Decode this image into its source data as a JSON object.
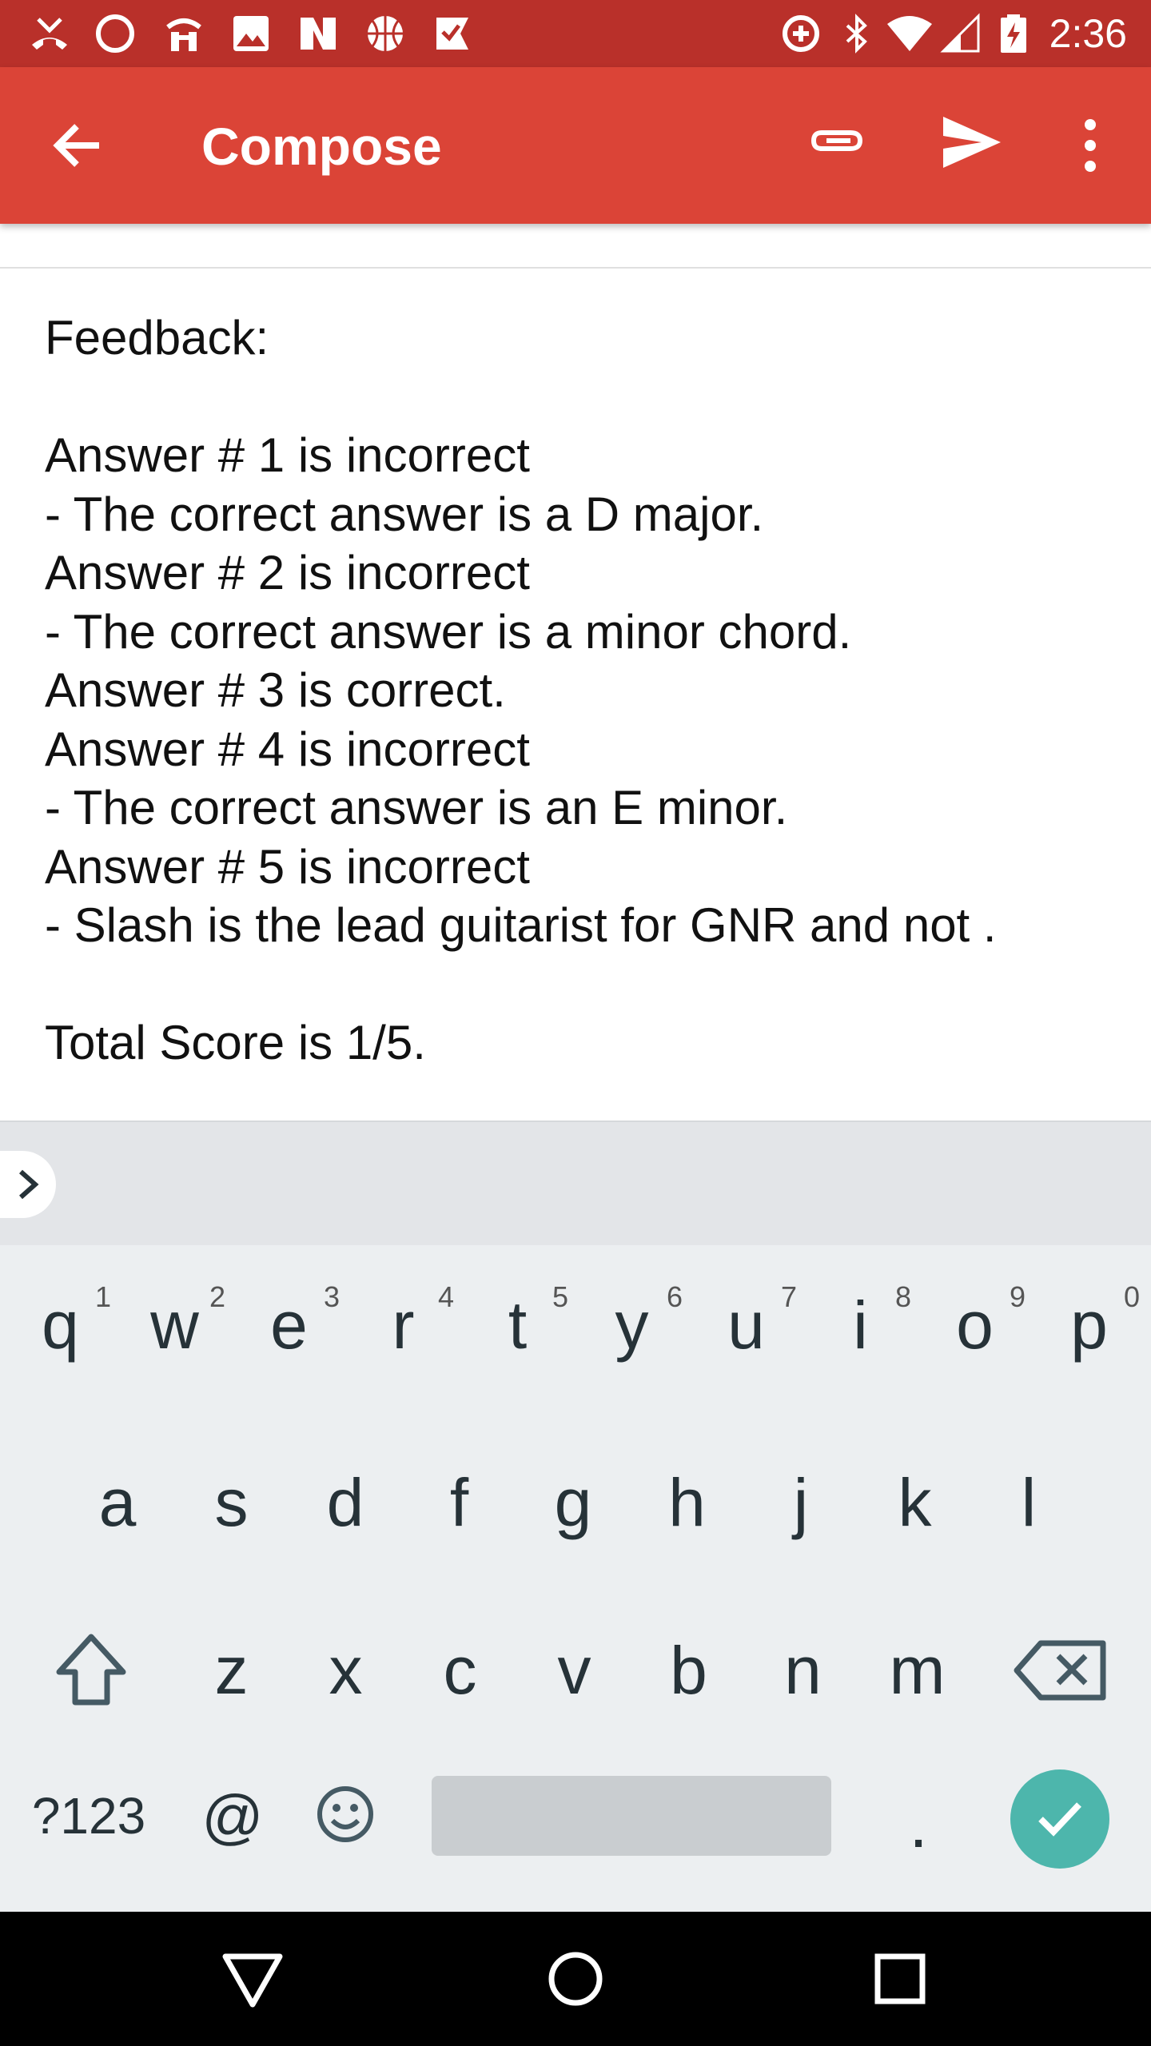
{
  "status_bar": {
    "time": "2:36",
    "left_icons": [
      "missed-call-icon",
      "circle-icon",
      "amtrak-icon",
      "photo-icon",
      "news-icon",
      "basketball-icon",
      "checkmark-flag-icon"
    ],
    "right_icons": [
      "data-saver-icon",
      "bluetooth-icon",
      "wifi-icon",
      "cell-signal-icon",
      "battery-charging-icon"
    ]
  },
  "app_bar": {
    "title": "Compose",
    "back_icon": "arrow-back-icon",
    "attach_icon": "paperclip-icon",
    "send_icon": "send-icon",
    "more_icon": "more-vert-icon",
    "color": "#db4437"
  },
  "compose": {
    "body_lines": [
      "Feedback:",
      "",
      "Answer # 1 is incorrect",
      "- The correct answer is a D major.",
      "Answer # 2 is incorrect",
      "- The correct answer is a minor chord.",
      "Answer # 3 is correct.",
      "Answer # 4 is incorrect",
      "- The correct answer is an E minor.",
      "Answer # 5 is incorrect",
      "- Slash is the lead guitarist for GNR and not .",
      "",
      "Total Score is 1/5."
    ]
  },
  "keyboard": {
    "row1": [
      {
        "char": "q",
        "hint": "1"
      },
      {
        "char": "w",
        "hint": "2"
      },
      {
        "char": "e",
        "hint": "3"
      },
      {
        "char": "r",
        "hint": "4"
      },
      {
        "char": "t",
        "hint": "5"
      },
      {
        "char": "y",
        "hint": "6"
      },
      {
        "char": "u",
        "hint": "7"
      },
      {
        "char": "i",
        "hint": "8"
      },
      {
        "char": "o",
        "hint": "9"
      },
      {
        "char": "p",
        "hint": "0"
      }
    ],
    "row2": [
      "a",
      "s",
      "d",
      "f",
      "g",
      "h",
      "j",
      "k",
      "l"
    ],
    "row3": [
      "z",
      "x",
      "c",
      "v",
      "b",
      "n",
      "m"
    ],
    "symbols_label": "?123",
    "at_label": "@",
    "period_label": ".",
    "accent": "#4db6ac"
  },
  "nav_bar": {
    "icons": [
      "nav-back-icon",
      "nav-home-icon",
      "nav-recents-icon"
    ]
  }
}
